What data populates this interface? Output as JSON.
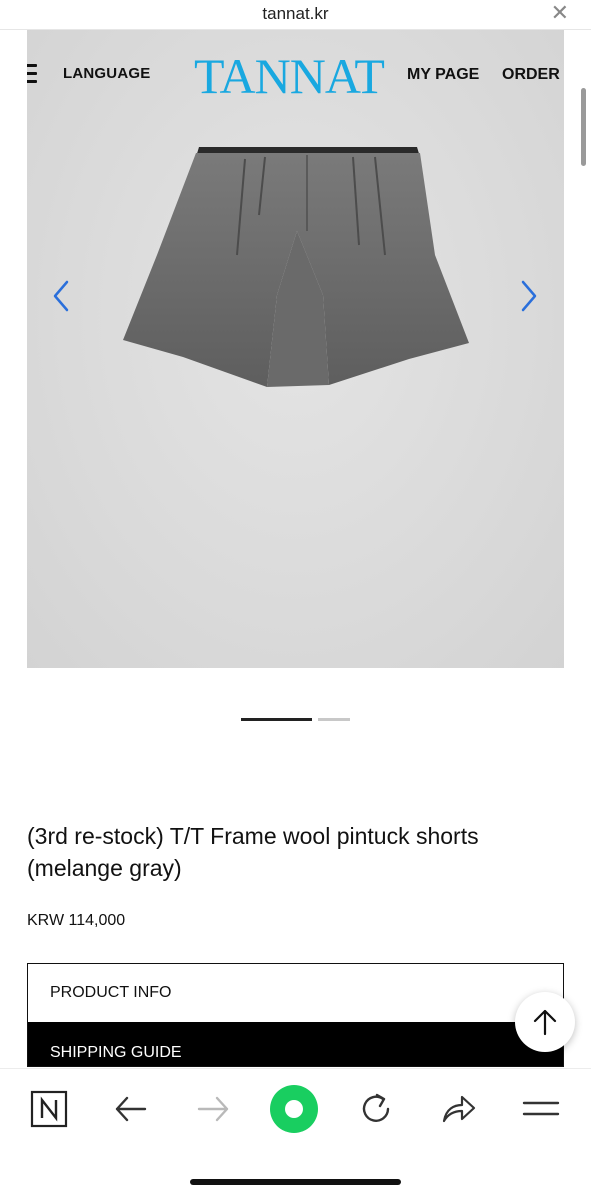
{
  "browser": {
    "url": "tannat.kr",
    "close_icon": "close-icon"
  },
  "header": {
    "menu_icon": "hamburger-icon",
    "language_label": "LANGUAGE",
    "logo_text": "TANNAT",
    "logo_color": "#19a8e0",
    "mypage_label": "MY PAGE",
    "order_label": "ORDER"
  },
  "gallery": {
    "prev_icon": "chevron-left-icon",
    "next_icon": "chevron-right-icon",
    "image": "gray-wool-pintuck-shorts",
    "current_slide": 1,
    "total_slides": 2
  },
  "product": {
    "title": "(3rd re-stock) T/T Frame wool pintuck shorts (melange gray)",
    "price": "KRW 114,000"
  },
  "tabs": {
    "info_label": "PRODUCT INFO",
    "shipping_label": "SHIPPING GUIDE"
  },
  "scroll_top_icon": "arrow-up-icon",
  "toolbar": {
    "items": [
      "naver-n-icon",
      "back-arrow-icon",
      "forward-arrow-icon",
      "green-dot-icon",
      "reload-icon",
      "share-icon",
      "menu-icon"
    ],
    "accent": "#19ce60"
  }
}
